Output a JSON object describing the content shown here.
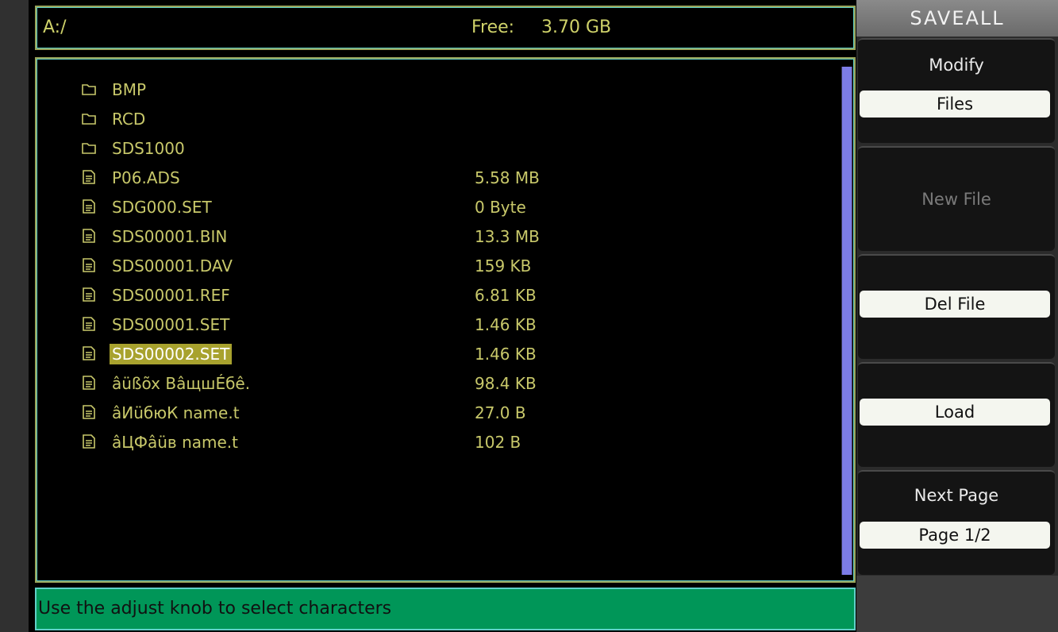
{
  "header": {
    "path": "A:/",
    "free_label": "Free:",
    "free_value": "3.70 GB"
  },
  "files": [
    {
      "name": "BMP",
      "size": "",
      "type": "folder-icon"
    },
    {
      "name": "RCD",
      "size": "",
      "type": "folder-icon"
    },
    {
      "name": "SDS1000",
      "size": "",
      "type": "folder-icon"
    },
    {
      "name": "P06.ADS",
      "size": "5.58 MB",
      "type": "file-icon"
    },
    {
      "name": "SDG000.SET",
      "size": "0 Byte",
      "type": "file-icon"
    },
    {
      "name": "SDS00001.BIN",
      "size": "13.3 MB",
      "type": "file-icon"
    },
    {
      "name": "SDS00001.DAV",
      "size": "159 KB",
      "type": "file-icon"
    },
    {
      "name": "SDS00001.REF",
      "size": "6.81 KB",
      "type": "file-icon"
    },
    {
      "name": "SDS00001.SET",
      "size": "1.46 KB",
      "type": "file-icon"
    },
    {
      "name": "SDS00002.SET",
      "size": "1.46 KB",
      "type": "file-icon",
      "selected": true
    },
    {
      "name": "âüßõx ВâщшÉбê.",
      "size": "98.4 KB",
      "type": "file-icon"
    },
    {
      "name": "âИüбюК name.t",
      "size": "27.0 B",
      "type": "file-icon"
    },
    {
      "name": "âЦФâüв name.t",
      "size": "102 B",
      "type": "file-icon"
    }
  ],
  "status": {
    "text": "Use the adjust knob to select characters"
  },
  "menu": {
    "title": "SAVEALL",
    "modify": {
      "label": "Modify",
      "value": "Files"
    },
    "new_file": {
      "label": "New File"
    },
    "del_file": {
      "value": "Del File"
    },
    "load": {
      "value": "Load"
    },
    "next_page": {
      "label": "Next Page",
      "value": "Page 1/2"
    }
  },
  "colors": {
    "text_yellow": "#c8c86a",
    "selection": "#a8a22e",
    "status_green": "#009658",
    "scroll_thumb": "#7c7ce6"
  }
}
